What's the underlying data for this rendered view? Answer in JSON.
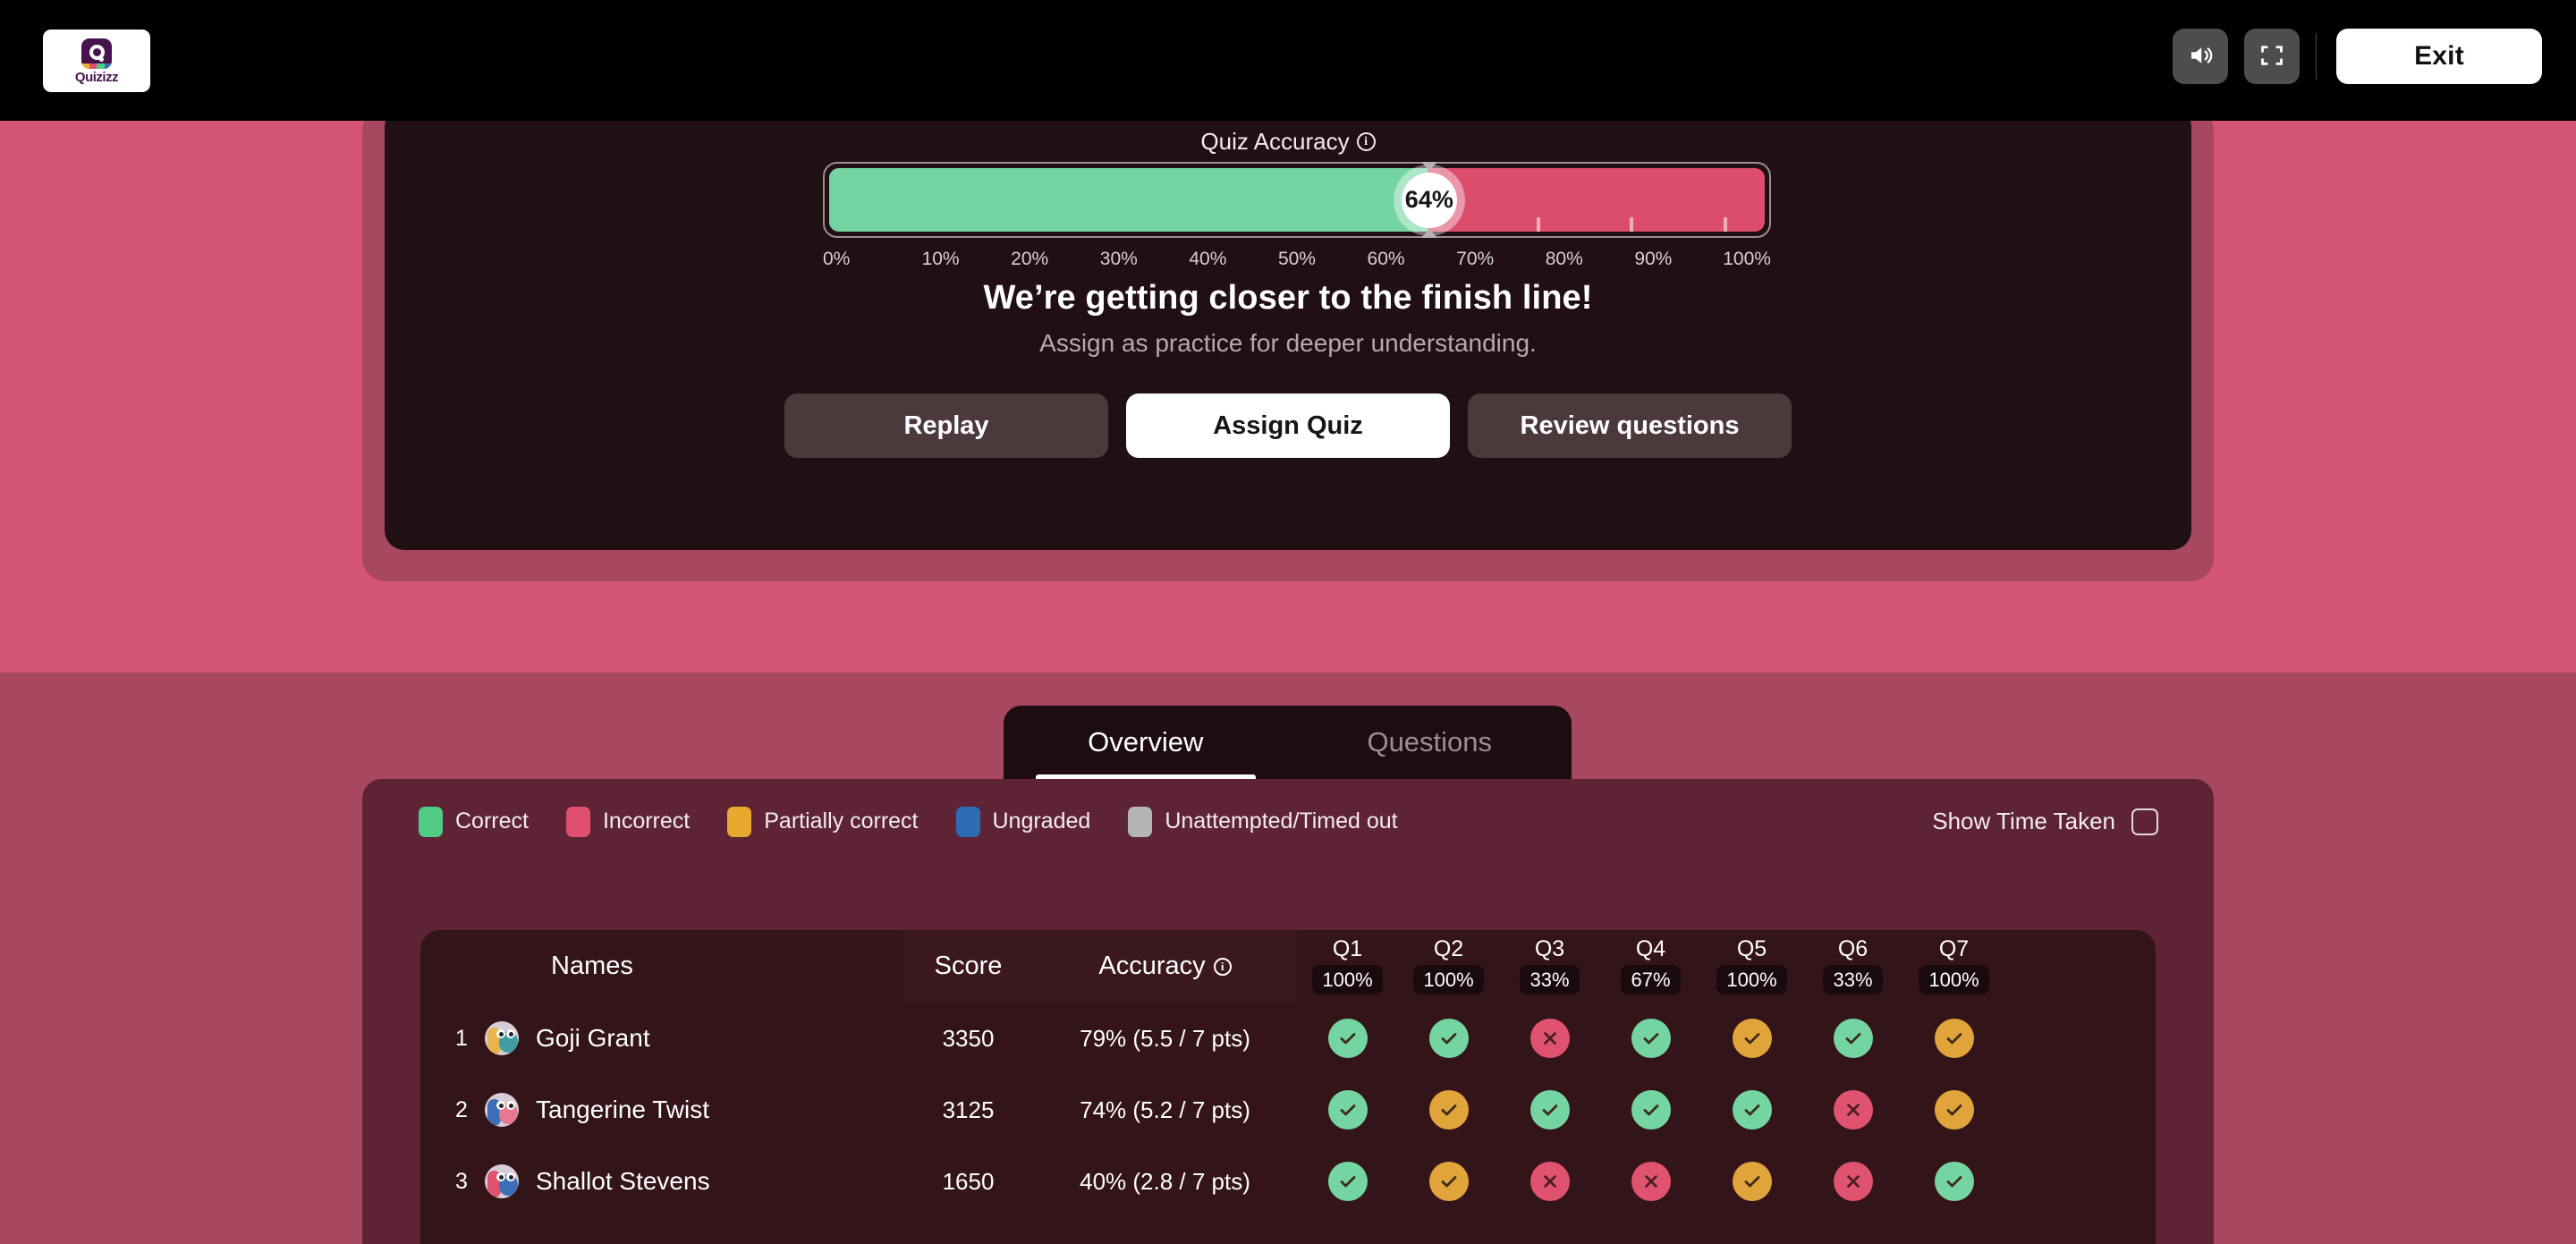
{
  "topbar": {
    "logo_word": "Quizizz",
    "logo_icon": "quizizz-logo-icon",
    "sound_icon": "speaker-icon",
    "fullscreen_icon": "fullscreen-icon",
    "exit_label": "Exit"
  },
  "results": {
    "accuracy_title": "Quiz Accuracy",
    "info_icon": "info-icon",
    "accuracy_value": "64%",
    "headline": "We’re getting closer to the finish line!",
    "subline": "Assign as practice for deeper understanding.",
    "scale": [
      "0%",
      "10%",
      "20%",
      "30%",
      "40%",
      "50%",
      "60%",
      "70%",
      "80%",
      "90%",
      "100%"
    ],
    "buttons": {
      "replay": "Replay",
      "assign": "Assign Quiz",
      "review": "Review questions"
    }
  },
  "chart_data": {
    "type": "bar",
    "title": "Quiz Accuracy",
    "value": 64,
    "unit": "%",
    "xlim": [
      0,
      100
    ],
    "ticks": [
      0,
      10,
      20,
      30,
      40,
      50,
      60,
      70,
      80,
      90,
      100
    ],
    "segments": [
      {
        "name": "Correct",
        "value": 64,
        "color": "#74d5a3"
      },
      {
        "name": "Incorrect",
        "value": 36,
        "color": "#dc4d6d"
      }
    ],
    "grid": false,
    "legend": "none"
  },
  "tabs": [
    {
      "label": "Overview",
      "active": true
    },
    {
      "label": "Questions",
      "active": false
    }
  ],
  "legend": [
    {
      "label": "Correct",
      "color": "#4fcb83"
    },
    {
      "label": "Incorrect",
      "color": "#e04f6d"
    },
    {
      "label": "Partially correct",
      "color": "#e8a92f"
    },
    {
      "label": "Ungraded",
      "color": "#2b6cb5"
    },
    {
      "label": "Unattempted/Timed out",
      "color": "#b5b5b5"
    }
  ],
  "show_time": {
    "label": "Show Time Taken",
    "checked": false
  },
  "table": {
    "headers": {
      "names": "Names",
      "score": "Score",
      "accuracy": "Accuracy"
    },
    "questions": [
      {
        "label": "Q1",
        "pct": "100%"
      },
      {
        "label": "Q2",
        "pct": "100%"
      },
      {
        "label": "Q3",
        "pct": "33%"
      },
      {
        "label": "Q4",
        "pct": "67%"
      },
      {
        "label": "Q5",
        "pct": "100%"
      },
      {
        "label": "Q6",
        "pct": "33%"
      },
      {
        "label": "Q7",
        "pct": "100%"
      }
    ],
    "rows": [
      {
        "rank": "1",
        "name": "Goji Grant",
        "score": "3350",
        "accuracy": "79% (5.5 / 7 pts)",
        "avatar_colors": [
          "#e8b44b",
          "#3f9ea3"
        ],
        "answers": [
          "correct",
          "correct",
          "incorrect",
          "correct",
          "partial",
          "correct",
          "partial"
        ]
      },
      {
        "rank": "2",
        "name": "Tangerine Twist",
        "score": "3125",
        "accuracy": "74% (5.2 / 7 pts)",
        "avatar_colors": [
          "#3c6fb5",
          "#e4798f"
        ],
        "answers": [
          "correct",
          "partial",
          "correct",
          "correct",
          "correct",
          "incorrect",
          "partial"
        ]
      },
      {
        "rank": "3",
        "name": "Shallot Stevens",
        "score": "1650",
        "accuracy": "40% (2.8 / 7 pts)",
        "avatar_colors": [
          "#e0536e",
          "#3c6fb5"
        ],
        "answers": [
          "correct",
          "partial",
          "incorrect",
          "incorrect",
          "partial",
          "incorrect",
          "correct"
        ]
      }
    ]
  },
  "colors": {
    "bg_upper": "#d45473",
    "bg_lower": "#a84760",
    "card_dark": "#211013",
    "panel": "#5e2334",
    "table": "#331419",
    "correct": "#74d5a3",
    "incorrect": "#e0536e",
    "partial": "#e0a43a"
  }
}
